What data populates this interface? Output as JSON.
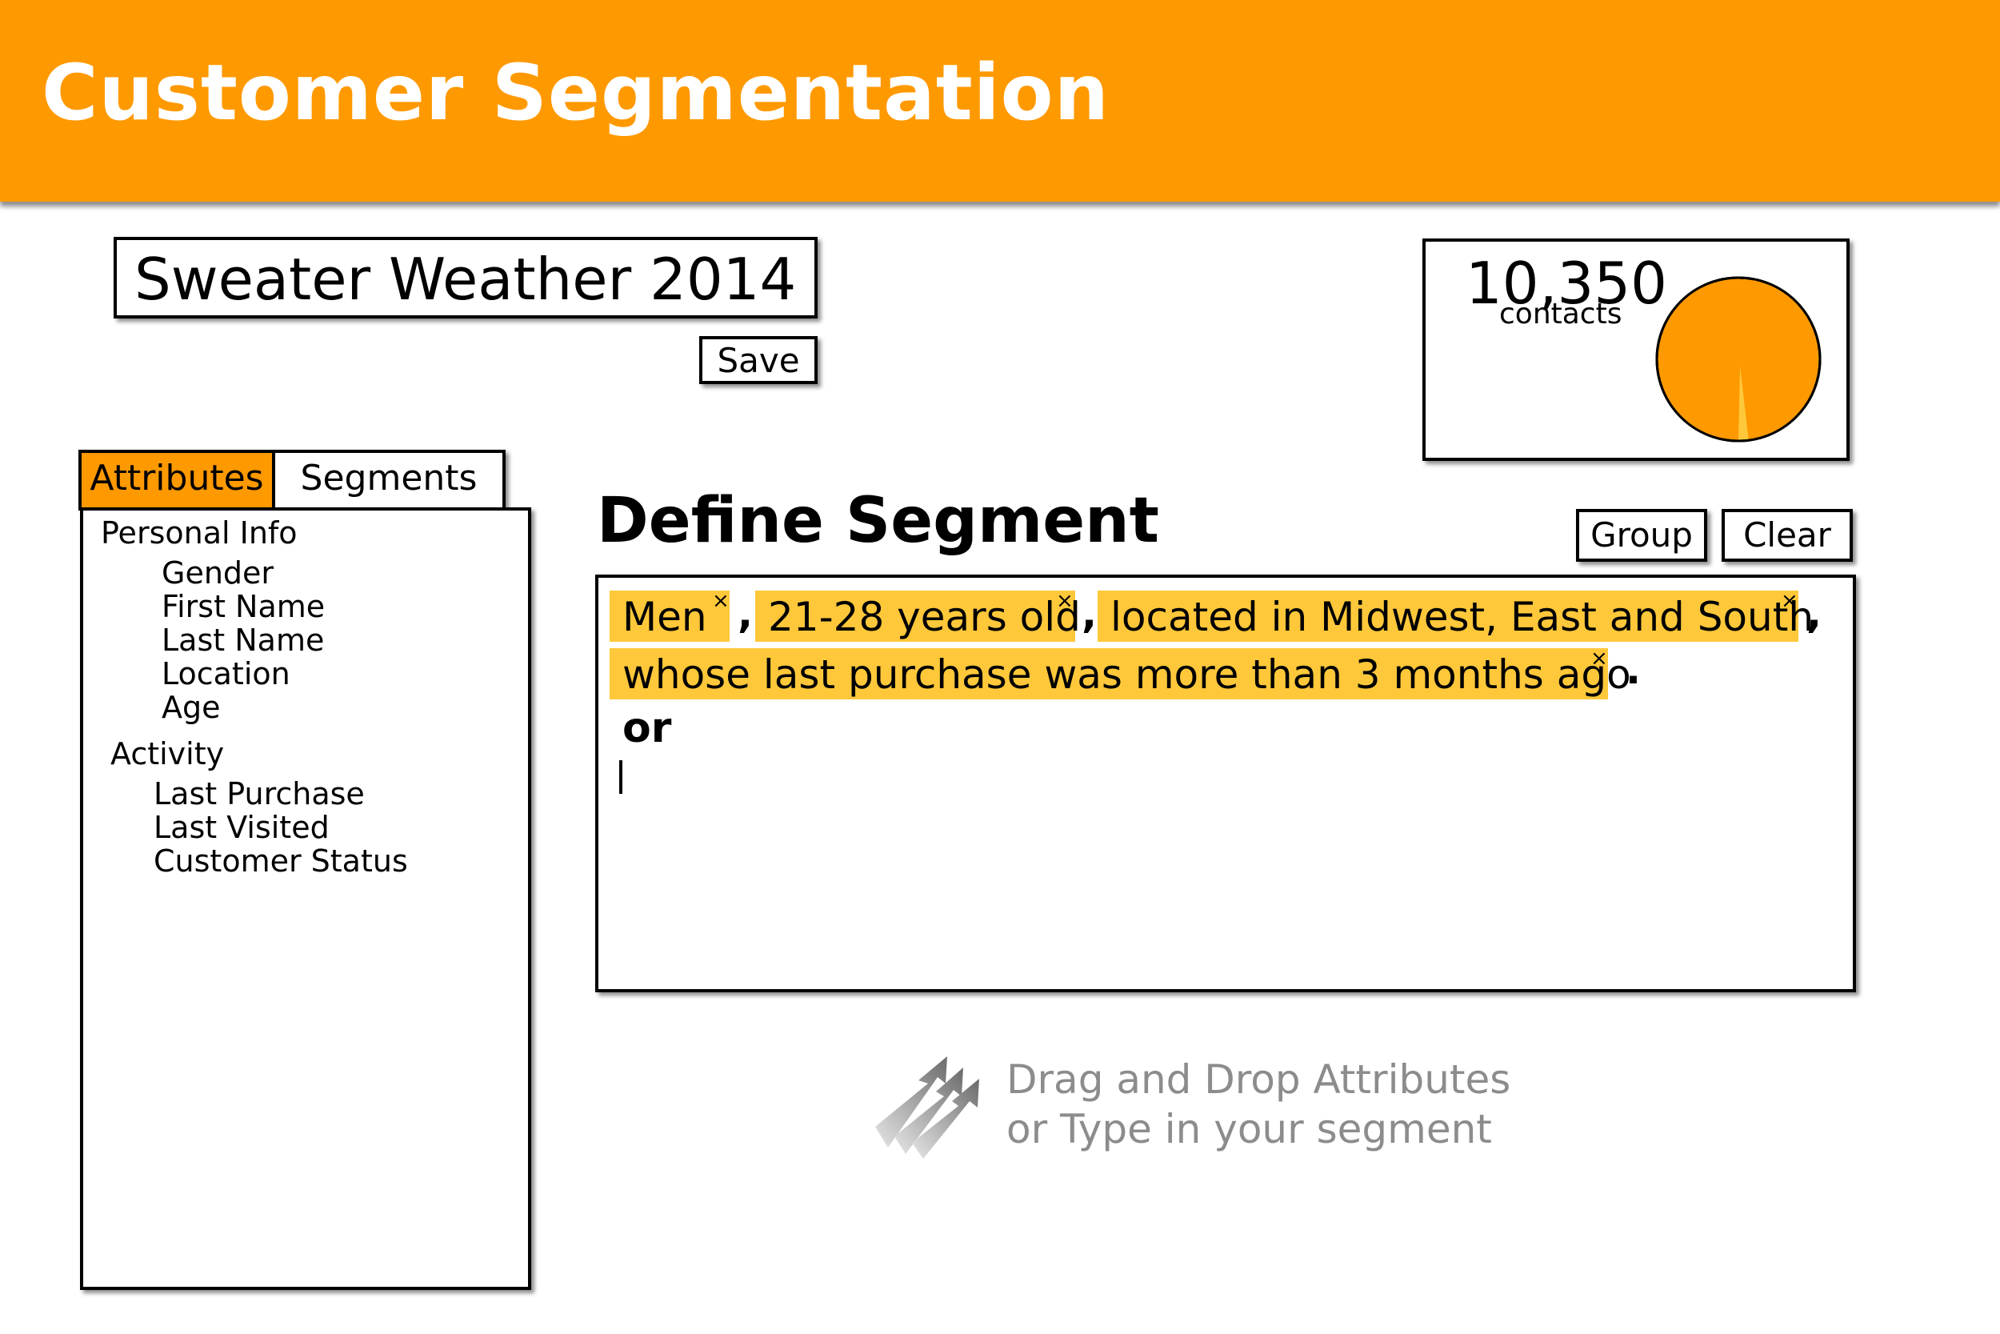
{
  "header": {
    "title": "Customer Segmentation"
  },
  "segment": {
    "name": "Sweater Weather 2014",
    "save_label": "Save"
  },
  "counter": {
    "count": "10,350",
    "label": "contacts",
    "matched_fraction": 0.02
  },
  "tabs": [
    {
      "label": "Attributes",
      "active": true
    },
    {
      "label": "Segments",
      "active": false
    }
  ],
  "attributes": {
    "groups": [
      {
        "label": "Personal Info",
        "items": [
          "Gender",
          "First Name",
          "Last Name",
          "Location",
          "Age"
        ]
      },
      {
        "label": "Activity",
        "items": [
          "Last Purchase",
          "Last Visited",
          "Customer Status"
        ]
      }
    ]
  },
  "define": {
    "title": "Define Segment",
    "group_label": "Group",
    "clear_label": "Clear",
    "chips": [
      "Men",
      "21-28 years old",
      "located in Midwest, East and South",
      "whose last purchase was more than 3 months ago"
    ],
    "remove_glyph": "×",
    "separators": [
      ",",
      ",",
      ",",
      "."
    ],
    "connector": "or"
  },
  "hint": {
    "line1": "Drag and Drop Attributes",
    "line2": "or Type in your segment"
  },
  "colors": {
    "accent": "#ff9900",
    "chip": "#ffc83a",
    "pie_slice": "#ffc83a",
    "hint_text": "#8c8c8c"
  }
}
